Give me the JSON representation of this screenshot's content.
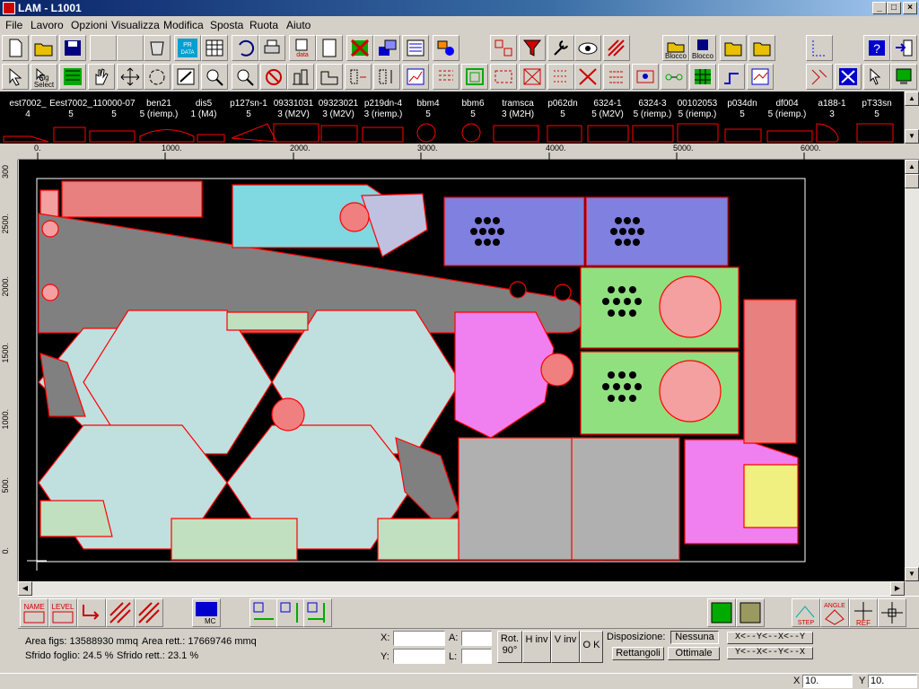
{
  "window": {
    "title": "LAM - L1001",
    "min": "_",
    "max": "□",
    "close": "×"
  },
  "menu": [
    "File",
    "Lavoro",
    "Opzioni",
    "Visualizza",
    "Modifica",
    "Sposta",
    "Ruota",
    "Aiuto"
  ],
  "toolbar": {
    "pr_data": "PR DATA",
    "data": "data",
    "fig_select": "Fig Select",
    "blocco1": "Blocco",
    "blocco2": "Blocco"
  },
  "pieces": [
    {
      "name": "est7002_",
      "qty": "4"
    },
    {
      "name": "Eest7002_",
      "qty": "5"
    },
    {
      "name": "110000-07",
      "qty": "5"
    },
    {
      "name": "ben21",
      "qty": "5 (riemp.)"
    },
    {
      "name": "dis5",
      "qty": "1 (M4)"
    },
    {
      "name": "p127sn-1",
      "qty": "5"
    },
    {
      "name": "09331031",
      "qty": "3 (M2V)"
    },
    {
      "name": "09323021",
      "qty": "3 (M2V)"
    },
    {
      "name": "p219dn-4",
      "qty": "3 (riemp.)"
    },
    {
      "name": "bbm4",
      "qty": "5"
    },
    {
      "name": "bbm6",
      "qty": "5"
    },
    {
      "name": "tramsca",
      "qty": "3 (M2H)"
    },
    {
      "name": "p062dn",
      "qty": "5"
    },
    {
      "name": "6324-1",
      "qty": "5 (M2V)"
    },
    {
      "name": "6324-3",
      "qty": "5 (riemp.)"
    },
    {
      "name": "00102053",
      "qty": "5 (riemp.)"
    },
    {
      "name": "p034dn",
      "qty": "5"
    },
    {
      "name": "df004",
      "qty": "5 (riemp.)"
    },
    {
      "name": "a188-1",
      "qty": "3"
    },
    {
      "name": "pT33sn",
      "qty": "5"
    }
  ],
  "ruler": {
    "top": [
      "0.",
      "1000.",
      "2000.",
      "3000.",
      "4000.",
      "5000.",
      "6000."
    ],
    "left": [
      "300",
      "2500.",
      "2000.",
      "1500.",
      "1000.",
      "500.",
      "0."
    ]
  },
  "bottom_toolbar": {
    "name": "NAME",
    "level": "LEVEL",
    "step": "STEP",
    "angle": "ANGLE",
    "ref": "REF",
    "mc": "MC"
  },
  "status": {
    "area_figs": "Area figs: 13588930 mmq",
    "area_rett": "Area rett.: 17669746 mmq",
    "sfrido_foglio": "Sfrido foglio: 24.5 %",
    "sfrido_rett": "Sfrido rett.: 23.1 %",
    "x_label": "X:",
    "y_label": "Y:",
    "a_label": "A:",
    "l_label": "L:",
    "x_value": "",
    "y_value": "",
    "a_value": "",
    "l_value": "",
    "rot": "Rot. 90°",
    "hinv": "H inv",
    "vinv": "V inv",
    "ok": "O K",
    "disposizione": "Disposizione:",
    "nessuna": "Nessuna",
    "rettangoli": "Rettangoli",
    "ottimale": "Ottimale",
    "order1": "X<--Y<--X<--Y",
    "order2": "Y<--X<--Y<--X"
  },
  "coords": {
    "x_label": "X",
    "x": "10.",
    "y_label": "Y",
    "y": "10."
  },
  "colors": {
    "sheet_border": "#ff0000",
    "bg": "#000000",
    "toolbar": "#d4d0c8"
  }
}
